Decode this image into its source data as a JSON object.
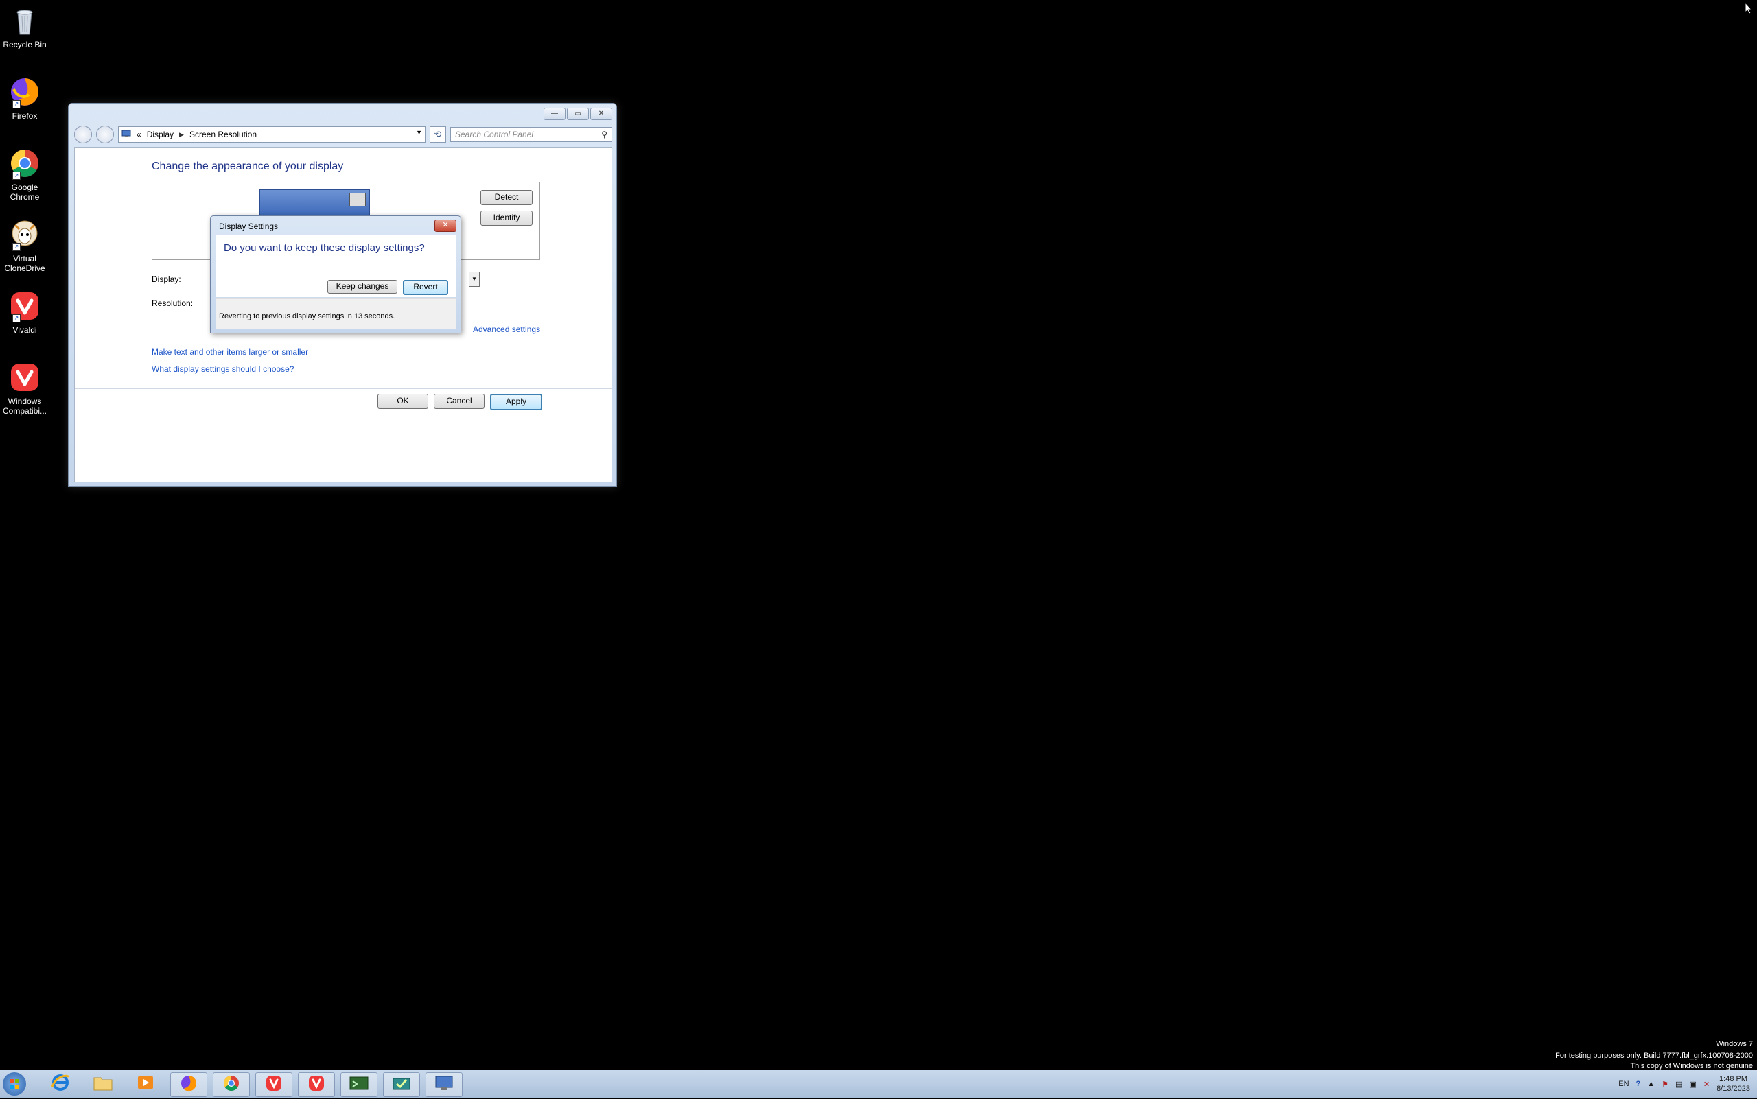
{
  "desktop": {
    "icons": [
      {
        "label": "Recycle Bin"
      },
      {
        "label": "Firefox"
      },
      {
        "label": "Google Chrome"
      },
      {
        "label": "Virtual CloneDrive"
      },
      {
        "label": "Vivaldi"
      },
      {
        "label": "Windows Compatibi..."
      }
    ]
  },
  "window": {
    "address": {
      "root": "«",
      "crumb1": "Display",
      "crumb2": "Screen Resolution"
    },
    "search_placeholder": "Search Control Panel",
    "title": "Change the appearance of your display",
    "detect_label": "Detect",
    "identify_label": "Identify",
    "display_label": "Display:",
    "resolution_label": "Resolution:",
    "advanced_link": "Advanced settings",
    "link_text_size": "Make text and other items larger or smaller",
    "link_help": "What display settings should I choose?",
    "ok_label": "OK",
    "cancel_label": "Cancel",
    "apply_label": "Apply"
  },
  "dialog": {
    "title": "Display Settings",
    "question": "Do you want to keep these display settings?",
    "keep_label": "Keep changes",
    "revert_label": "Revert",
    "countdown": "Reverting to previous display settings in 13 seconds."
  },
  "watermark": {
    "line1": "Windows 7",
    "line2": "For testing purposes only. Build 7777.fbl_grfx.100708-2000",
    "line3": "This copy of Windows is not genuine"
  },
  "taskbar": {
    "tray_lang": "EN",
    "time": "1:48 PM",
    "date": "8/13/2023"
  },
  "colors": {
    "link": "#1e56c8",
    "title_blue": "#1e3287",
    "desktop_bg": "#000000"
  }
}
